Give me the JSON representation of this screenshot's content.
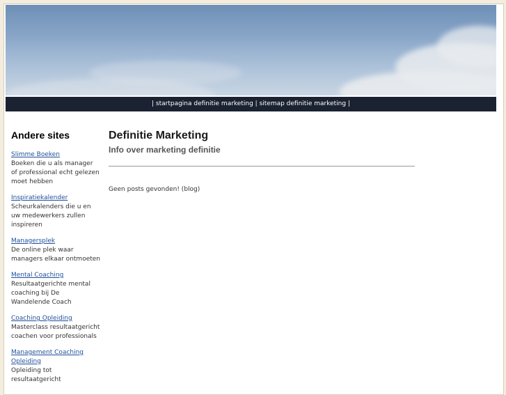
{
  "nav": {
    "separator_left": "| ",
    "home_link": "startpagina definitie marketing",
    "separator_mid": " | ",
    "sitemap_link": "sitemap definitie marketing",
    "separator_right": " |"
  },
  "sidebar": {
    "title": "Andere sites",
    "sites": [
      {
        "link": "Slimme Boeken",
        "description": "Boeken die u als manager of professional echt gelezen moet hebben"
      },
      {
        "link": "Inspiratiekalender",
        "description": "Scheurkalenders die u en uw medewerkers zullen inspireren"
      },
      {
        "link": "Managersplek",
        "description": "De online plek waar managers elkaar ontmoeten"
      },
      {
        "link": "Mental Coaching",
        "description": "Resultaatgerichte mental coaching bij De Wandelende Coach"
      },
      {
        "link": "Coaching Opleiding",
        "description": "Masterclass resultaatgericht coachen voor professionals"
      },
      {
        "link": "Management Coaching Opleiding",
        "description": "Opleiding tot resultaatgericht"
      }
    ]
  },
  "main": {
    "title": "Definitie Marketing",
    "subtitle": "Info over marketing definitie",
    "no_posts": "Geen posts gevonden! (blog)"
  }
}
